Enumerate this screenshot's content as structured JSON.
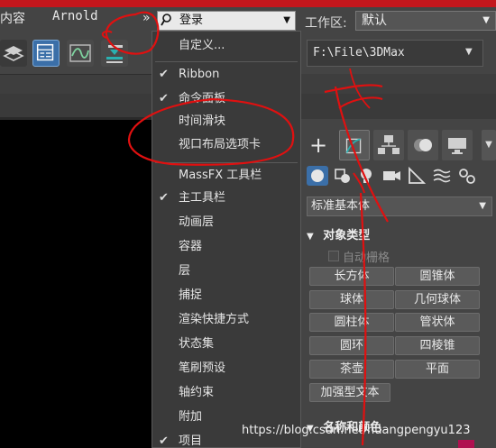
{
  "menubar": {
    "content_label": "内容",
    "arnold_label": "Arnold",
    "overflow_label": "»",
    "login_label": "登录",
    "workspace_label": "工作区:",
    "workspace_value": "默认"
  },
  "toolbar": {
    "path_value": "F:\\File\\3DMax"
  },
  "dropdown": {
    "customize_label": "自定义...",
    "items": [
      {
        "label": "Ribbon",
        "checked": true
      },
      {
        "label": "命令面板",
        "checked": true
      },
      {
        "label": "时间滑块",
        "checked": false
      },
      {
        "label": "视口布局选项卡",
        "checked": false
      },
      {
        "label": "MassFX 工具栏",
        "checked": false
      },
      {
        "label": "主工具栏",
        "checked": true
      },
      {
        "label": "动画层",
        "checked": false
      },
      {
        "label": "容器",
        "checked": false
      },
      {
        "label": "层",
        "checked": false
      },
      {
        "label": "捕捉",
        "checked": false
      },
      {
        "label": "渲染快捷方式",
        "checked": false
      },
      {
        "label": "状态集",
        "checked": false
      },
      {
        "label": "笔刷预设",
        "checked": false
      },
      {
        "label": "轴约束",
        "checked": false
      },
      {
        "label": "附加",
        "checked": false
      },
      {
        "label": "项目",
        "checked": true
      }
    ]
  },
  "command_panel": {
    "plus_label": "+",
    "category_value": "标准基本体",
    "object_type_header": "对象类型",
    "autogrid_label": "自动栅格",
    "buttons": [
      "长方体",
      "圆锥体",
      "球体",
      "几何球体",
      "圆柱体",
      "管状体",
      "圆环",
      "四棱锥",
      "茶壶",
      "平面",
      "加强型文本"
    ],
    "name_color_header": "名称和颜色"
  },
  "watermark": "https://blog.csdn.net/huangpengyu123",
  "colors": {
    "red_strip": "#c4161c",
    "accent_blue": "#3b6fa8",
    "annotation_red": "#e01010",
    "name_swatch": "#b01050"
  }
}
